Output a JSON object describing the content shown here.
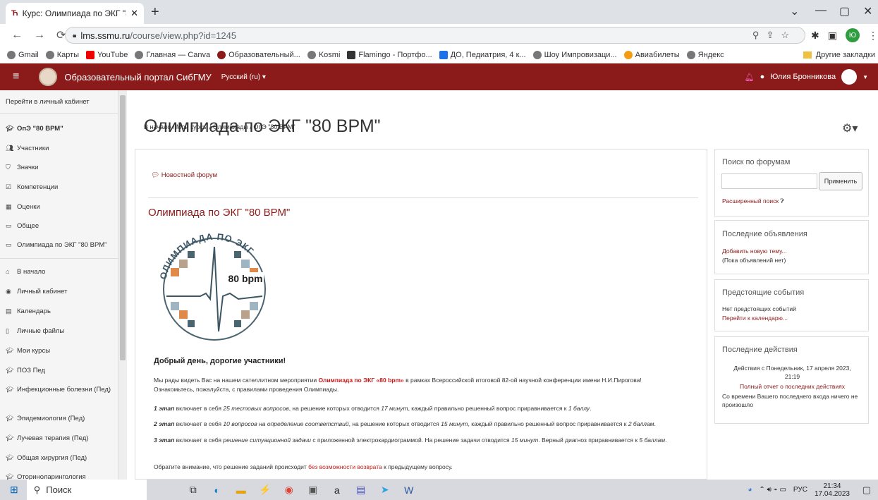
{
  "browser": {
    "tab_title": "Курс: Олимпиада по ЭКГ \"80 ВР",
    "tab_icon": "Ћ",
    "url_host": "lms.ssmu.ru",
    "url_path": "/course/view.php?id=1245",
    "bookmarks": [
      "Gmail",
      "Карты",
      "YouTube",
      "Главная — Canva",
      "Образовательный...",
      "Kosmi",
      "Flamingo - Портфо...",
      "ДО, Педиатрия, 4 к...",
      "Шоу Импровизаци...",
      "Авиабилеты",
      "Яндекс"
    ],
    "other_bookmarks": "Другие закладки",
    "profile_initial": "Ю"
  },
  "topnav": {
    "brand": "Образовательный портал СибГМУ",
    "lang": "Русский (ru) ▾",
    "user": "Юлия Бронникова"
  },
  "sidebar": {
    "items": [
      {
        "label": "Перейти в личный кабинет",
        "icon": ""
      },
      {
        "label": "ОпЭ \"80 ВРМ\"",
        "icon": "graduation-cap-icon"
      },
      {
        "label": "Участники",
        "icon": "users-icon"
      },
      {
        "label": "Значки",
        "icon": "shield-icon"
      },
      {
        "label": "Компетенции",
        "icon": "check-square-icon"
      },
      {
        "label": "Оценки",
        "icon": "table-icon"
      },
      {
        "label": "Общее",
        "icon": "folder-icon"
      },
      {
        "label": "Олимпиада по ЭКГ \"80 ВРМ\"",
        "icon": "folder-icon"
      },
      {
        "label": "В начало",
        "icon": "home-icon"
      },
      {
        "label": "Личный кабинет",
        "icon": "dashboard-icon"
      },
      {
        "label": "Календарь",
        "icon": "calendar-icon"
      },
      {
        "label": "Личные файлы",
        "icon": "file-icon"
      },
      {
        "label": "Мои курсы",
        "icon": "graduation-cap-icon"
      },
      {
        "label": "ПОЗ Пед",
        "icon": "graduation-cap-icon"
      },
      {
        "label": "Инфекционные болезни (Пед)",
        "icon": "graduation-cap-icon"
      },
      {
        "label": "Эпидемиология (Пед)",
        "icon": "graduation-cap-icon"
      },
      {
        "label": "Лучевая терапия (Пед)",
        "icon": "graduation-cap-icon"
      },
      {
        "label": "Общая хирургия (Пед)",
        "icon": "graduation-cap-icon"
      },
      {
        "label": "Оториноларингология",
        "icon": "graduation-cap-icon"
      }
    ]
  },
  "page": {
    "title": "Олимпиада по ЭКГ \"80 ВРМ\"",
    "breadcrumb": "В начало / Мои курсы / Олимпиады / ОпЭ \"80 ВРМ\""
  },
  "main": {
    "forum_link": "Новостной форум",
    "section_title": "Олимпиада по ЭКГ \"80 ВРМ\"",
    "emblem_text_top": "ОЛИМПИАДА ПО ЭКГ",
    "emblem_bpm": "80 bpm",
    "greeting": "Добрый день, дорогие участники!",
    "p1_a": "Мы рады видеть Вас на нашем сателлитном мероприятии ",
    "p1_b": "Олимпиада по ЭКГ «80 bpm»",
    "p1_c": " в рамках Всероссийской итоговой 82-ой научной конференции имени Н.И.Пирогова!",
    "p1_d": "Ознакомьтесь, пожалуйста, с правилами проведения Олимпиады.",
    "s1_a": "1 этап",
    "s1_b": " включает в себя ",
    "s1_c": "25 тестовых вопросов",
    "s1_d": ", на решение которых отводится ",
    "s1_e": "17 минут",
    "s1_f": ", каждый правильно решенный вопрос приравнивается к ",
    "s1_g": "1 баллу",
    "s1_h": ".",
    "s2_a": "2 этап",
    "s2_b": " включает в себя ",
    "s2_c": "10 вопросов на определение соответствий",
    "s2_d": ", на решение которых отводится ",
    "s2_e": "15 минут",
    "s2_f": ", каждый правильно решенный вопрос приравнивается к ",
    "s2_g": "2 баллам",
    "s2_h": ".",
    "s3_a": "3 этап",
    "s3_b": " включает в себя ",
    "s3_c": "решение ситуационной задачи",
    "s3_d": " с приложенной электрокардиограммой. На решение задачи отводится ",
    "s3_e": "15 минут",
    "s3_f": ". Верный диагноз приравнивается к ",
    "s3_g": "5 баллам",
    "s3_h": ".",
    "note_a": "Обратите внимание, что решение заданий происходит ",
    "note_b": "без возможности возврата",
    "note_c": " к предыдущему вопросу."
  },
  "blocks": {
    "search": {
      "title": "Поиск по форумам",
      "button": "Применить",
      "advanced": "Расширенный поиск"
    },
    "news": {
      "title": "Последние объявления",
      "add": "Добавить новую тему...",
      "none": "(Пока объявлений нет)"
    },
    "events": {
      "title": "Предстоящие события",
      "none": "Нет предстоящих событий",
      "go": "Перейти к календарю..."
    },
    "activity": {
      "title": "Последние действия",
      "since": "Действия с Понедельник, 17 апреля 2023, 21:19",
      "report": "Полный отчет о последних действиях",
      "nothing": "Со времени Вашего последнего входа ничего не произошло"
    }
  },
  "taskbar": {
    "search": "Поиск",
    "lang": "РУС",
    "time": "21:34",
    "date": "17.04.2023"
  }
}
